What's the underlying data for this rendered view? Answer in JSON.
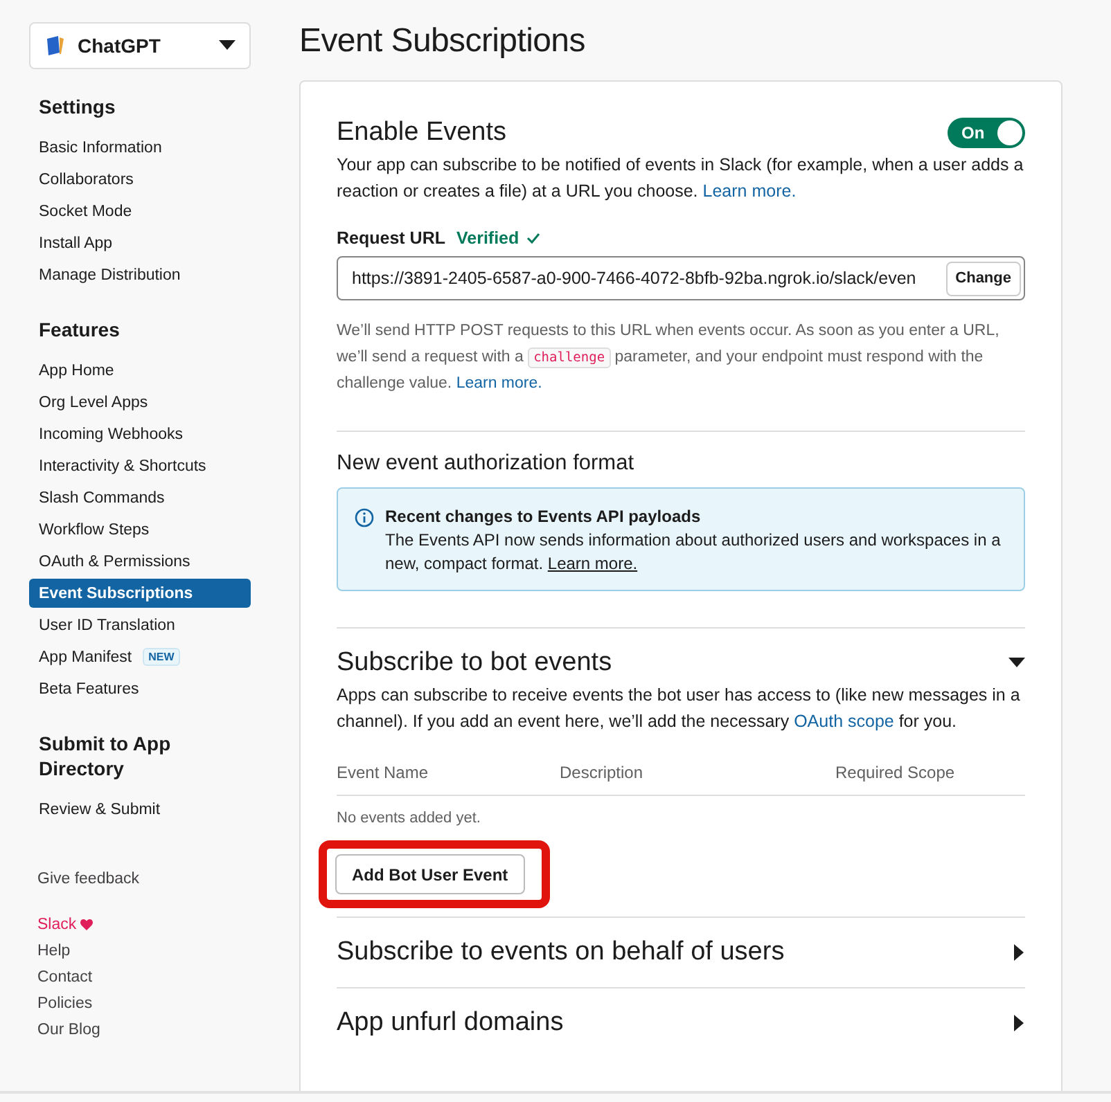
{
  "app_selector": {
    "name": "ChatGPT"
  },
  "sidebar": {
    "groups": [
      {
        "title": "Settings",
        "items": [
          {
            "label": "Basic Information",
            "selected": false
          },
          {
            "label": "Collaborators",
            "selected": false
          },
          {
            "label": "Socket Mode",
            "selected": false
          },
          {
            "label": "Install App",
            "selected": false
          },
          {
            "label": "Manage Distribution",
            "selected": false
          }
        ]
      },
      {
        "title": "Features",
        "items": [
          {
            "label": "App Home",
            "selected": false
          },
          {
            "label": "Org Level Apps",
            "selected": false
          },
          {
            "label": "Incoming Webhooks",
            "selected": false
          },
          {
            "label": "Interactivity & Shortcuts",
            "selected": false
          },
          {
            "label": "Slash Commands",
            "selected": false
          },
          {
            "label": "Workflow Steps",
            "selected": false
          },
          {
            "label": "OAuth & Permissions",
            "selected": false
          },
          {
            "label": "Event Subscriptions",
            "selected": true
          },
          {
            "label": "User ID Translation",
            "selected": false
          },
          {
            "label": "App Manifest",
            "selected": false,
            "badge": "NEW"
          },
          {
            "label": "Beta Features",
            "selected": false
          }
        ]
      },
      {
        "title": "Submit to App Directory",
        "items": [
          {
            "label": "Review & Submit",
            "selected": false
          }
        ]
      }
    ],
    "feedback": "Give feedback",
    "footer_links": [
      {
        "label": "Slack",
        "brand": true
      },
      {
        "label": "Help",
        "brand": false
      },
      {
        "label": "Contact",
        "brand": false
      },
      {
        "label": "Policies",
        "brand": false
      },
      {
        "label": "Our Blog",
        "brand": false
      }
    ]
  },
  "page_title": "Event Subscriptions",
  "enable_events": {
    "title": "Enable Events",
    "toggle": {
      "label": "On",
      "on": true
    },
    "description": [
      {
        "kind": "text",
        "text": "Your app can subscribe to be notified of events in Slack (for example, when a user adds a reaction or creates a file) at a URL you choose. "
      },
      {
        "kind": "link",
        "text": "Learn more."
      }
    ],
    "request_url": {
      "label": "Request URL",
      "status": "Verified",
      "verified": true,
      "value": "https://3891-2405-6587-a0-900-7466-4072-8bfb-92ba.ngrok.io/slack/even",
      "button": "Change"
    },
    "note": [
      {
        "kind": "text",
        "text": "We’ll send HTTP POST requests to this URL when events occur. As soon as you enter a URL, we’ll send a request with a "
      },
      {
        "kind": "code",
        "text": "challenge"
      },
      {
        "kind": "text",
        "text": " parameter, and your endpoint must respond with the challenge value. "
      },
      {
        "kind": "link",
        "text": "Learn more."
      }
    ]
  },
  "authorization_format": {
    "title": "New event authorization format",
    "notice": {
      "title": "Recent changes to Events API payloads",
      "body": [
        {
          "kind": "text",
          "text": "The Events API now sends information about authorized users and workspaces in a new, compact format. "
        },
        {
          "kind": "underline",
          "text": "Learn more."
        }
      ]
    }
  },
  "sections": [
    {
      "title": "Subscribe to bot events",
      "expanded": true,
      "description": [
        {
          "kind": "text",
          "text": "Apps can subscribe to receive events the bot user has access to (like new messages in a channel). If you add an event here, we’ll add the necessary "
        },
        {
          "kind": "link",
          "text": "OAuth scope"
        },
        {
          "kind": "text",
          "text": " for you."
        }
      ],
      "table": {
        "columns": [
          "Event Name",
          "Description",
          "Required Scope"
        ],
        "empty": "No events added yet."
      },
      "button": {
        "label": "Add Bot User Event",
        "highlighted": true
      }
    },
    {
      "title": "Subscribe to events on behalf of users",
      "expanded": false
    },
    {
      "title": "App unfurl domains",
      "expanded": false
    }
  ]
}
